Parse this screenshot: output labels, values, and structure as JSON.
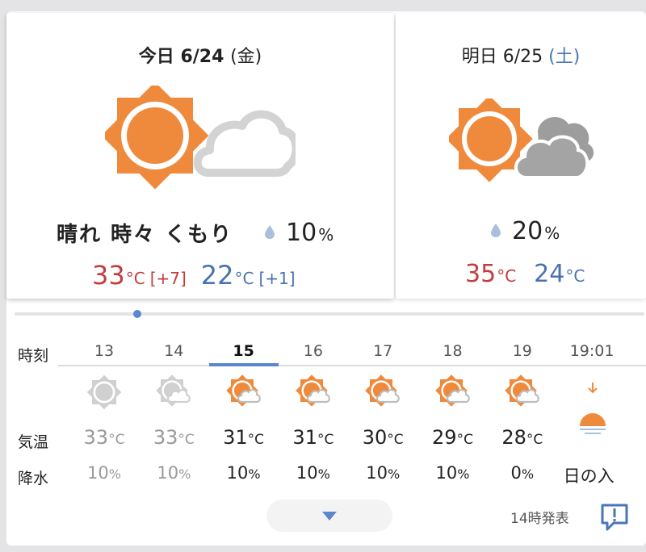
{
  "today": {
    "label": "今日",
    "date": "6/24",
    "dow": "(金)",
    "weather": "晴れ 時々 くもり",
    "precip_value": "10",
    "precip_unit": "%",
    "high": "33",
    "high_diff": "[+7]",
    "low": "22",
    "low_diff": "[+1]",
    "temp_unit": "°C",
    "icon": "sun-with-cloud-icon"
  },
  "tomorrow": {
    "label": "明日",
    "date": "6/25",
    "dow": "(土)",
    "precip_value": "20",
    "precip_unit": "%",
    "high": "35",
    "low": "24",
    "temp_unit": "°C",
    "icon": "sun-with-gray-clouds-icon"
  },
  "hourly": {
    "labels": {
      "time": "時刻",
      "temp": "気温",
      "rain": "降水"
    },
    "hours": [
      {
        "hour": "13",
        "temp": "33",
        "rain": "10",
        "state": "past",
        "icon": "sun-icon"
      },
      {
        "hour": "14",
        "temp": "33",
        "rain": "10",
        "state": "past",
        "icon": "sun-cloud-icon"
      },
      {
        "hour": "15",
        "temp": "31",
        "rain": "10",
        "state": "current",
        "icon": "sun-cloud-icon"
      },
      {
        "hour": "16",
        "temp": "31",
        "rain": "10",
        "state": "future",
        "icon": "sun-cloud-icon"
      },
      {
        "hour": "17",
        "temp": "30",
        "rain": "10",
        "state": "future",
        "icon": "sun-cloud-icon"
      },
      {
        "hour": "18",
        "temp": "29",
        "rain": "10",
        "state": "future",
        "icon": "sun-cloud-icon"
      },
      {
        "hour": "19",
        "temp": "28",
        "rain": "0",
        "state": "future",
        "icon": "sun-cloud-icon"
      }
    ],
    "sunset": {
      "time": "19:01",
      "label": "日の入",
      "icon": "sunset-icon"
    },
    "temp_unit": "°C",
    "rain_unit": "%"
  },
  "footer": {
    "issued": "14時発表",
    "expand_icon": "triangle-down-icon",
    "report_icon": "report-bubble-icon"
  },
  "colors": {
    "sun": "#ef8a3c",
    "sun_inner": "#f39a4c",
    "high": "#c33c3c",
    "low": "#4a72b0",
    "accent": "#5b87cf"
  }
}
